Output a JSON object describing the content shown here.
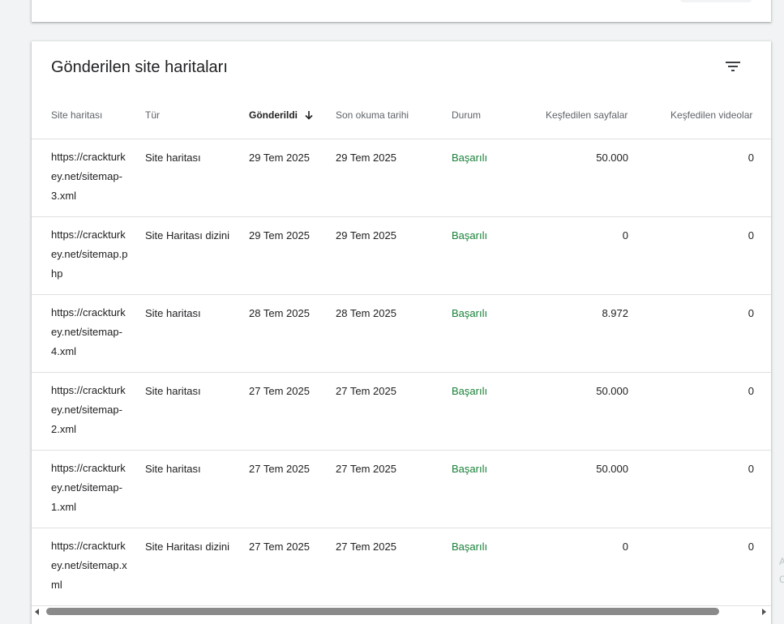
{
  "card": {
    "title": "Gönderilen site haritaları",
    "filter_icon": "filter-list-icon"
  },
  "table": {
    "columns": [
      {
        "key": "sitemap",
        "label": "Site haritası"
      },
      {
        "key": "type",
        "label": "Tür"
      },
      {
        "key": "submitted",
        "label": "Gönderildi",
        "sorted": "desc"
      },
      {
        "key": "last_read",
        "label": "Son okuma tarihi"
      },
      {
        "key": "status",
        "label": "Durum"
      },
      {
        "key": "pages",
        "label": "Keşfedilen sayfalar"
      },
      {
        "key": "videos",
        "label": "Keşfedilen videolar"
      }
    ],
    "rows": [
      {
        "sitemap": "https://crackturkey.net/sitemap-3.xml",
        "type": "Site haritası",
        "submitted": "29 Tem 2025",
        "last_read": "29 Tem 2025",
        "status": "Başarılı",
        "pages": "50.000",
        "videos": "0"
      },
      {
        "sitemap": "https://crackturkey.net/sitemap.php",
        "type": "Site Haritası dizini",
        "submitted": "29 Tem 2025",
        "last_read": "29 Tem 2025",
        "status": "Başarılı",
        "pages": "0",
        "videos": "0"
      },
      {
        "sitemap": "https://crackturkey.net/sitemap-4.xml",
        "type": "Site haritası",
        "submitted": "28 Tem 2025",
        "last_read": "28 Tem 2025",
        "status": "Başarılı",
        "pages": "8.972",
        "videos": "0"
      },
      {
        "sitemap": "https://crackturkey.net/sitemap-2.xml",
        "type": "Site haritası",
        "submitted": "27 Tem 2025",
        "last_read": "27 Tem 2025",
        "status": "Başarılı",
        "pages": "50.000",
        "videos": "0"
      },
      {
        "sitemap": "https://crackturkey.net/sitemap-1.xml",
        "type": "Site haritası",
        "submitted": "27 Tem 2025",
        "last_read": "27 Tem 2025",
        "status": "Başarılı",
        "pages": "50.000",
        "videos": "0"
      },
      {
        "sitemap": "https://crackturkey.net/sitemap.xml",
        "type": "Site Haritası dizini",
        "submitted": "27 Tem 2025",
        "last_read": "27 Tem 2025",
        "status": "Başarılı",
        "pages": "0",
        "videos": "0"
      }
    ]
  },
  "colors": {
    "status_success": "#188038",
    "accent": "#1a73e8"
  },
  "edge_text": [
    "A",
    "C"
  ]
}
